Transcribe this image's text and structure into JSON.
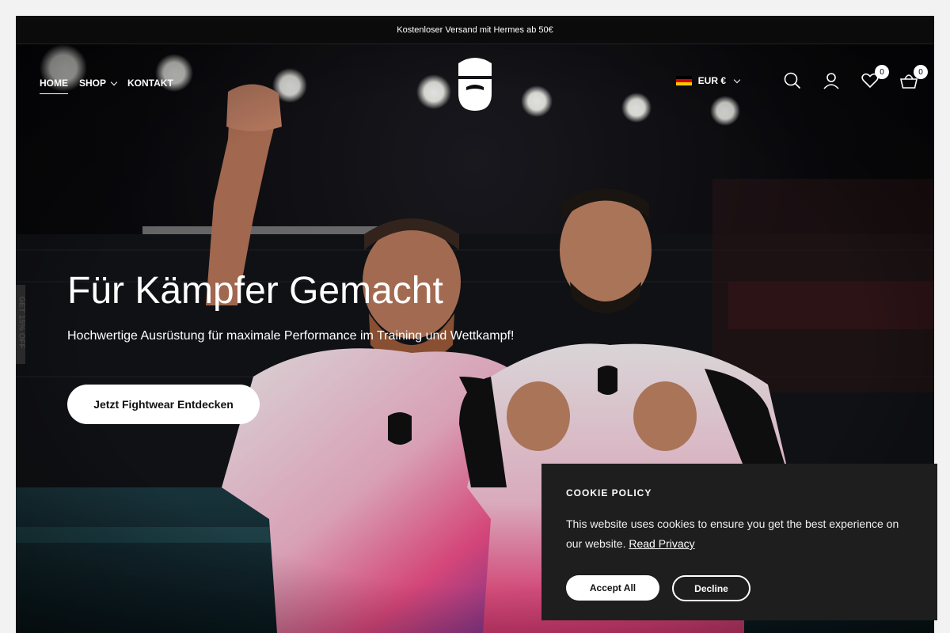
{
  "announcement": "Kostenloser Versand mit Hermes ab 50€",
  "nav": {
    "items": [
      {
        "label": "HOME",
        "active": true
      },
      {
        "label": "SHOP",
        "has_dropdown": true
      },
      {
        "label": "KONTAKT"
      }
    ]
  },
  "logo": {
    "icon": "bearded-man-logo"
  },
  "header_tools": {
    "currency": "EUR €",
    "flag": "germany-flag",
    "wishlist_count": "0",
    "cart_count": "0"
  },
  "hero": {
    "title": "Für Kämpfer Gemacht",
    "subtitle": "Hochwertige Ausrüstung für maximale Performance im Training und Wettkampf!",
    "cta": "Jetzt Fightwear Entdecken"
  },
  "side_tab": {
    "label": "GET 15% OFF"
  },
  "cookie": {
    "title": "COOKIE POLICY",
    "text": "This website uses cookies to ensure you get the best experience on our website.",
    "link": "Read Privacy",
    "accept": "Accept All",
    "decline": "Decline"
  },
  "colors": {
    "accent": "#ffffff",
    "dark": "#0b0b0b",
    "popup_bg": "#1e1e1e",
    "shirt_pink": "#f2508a"
  }
}
